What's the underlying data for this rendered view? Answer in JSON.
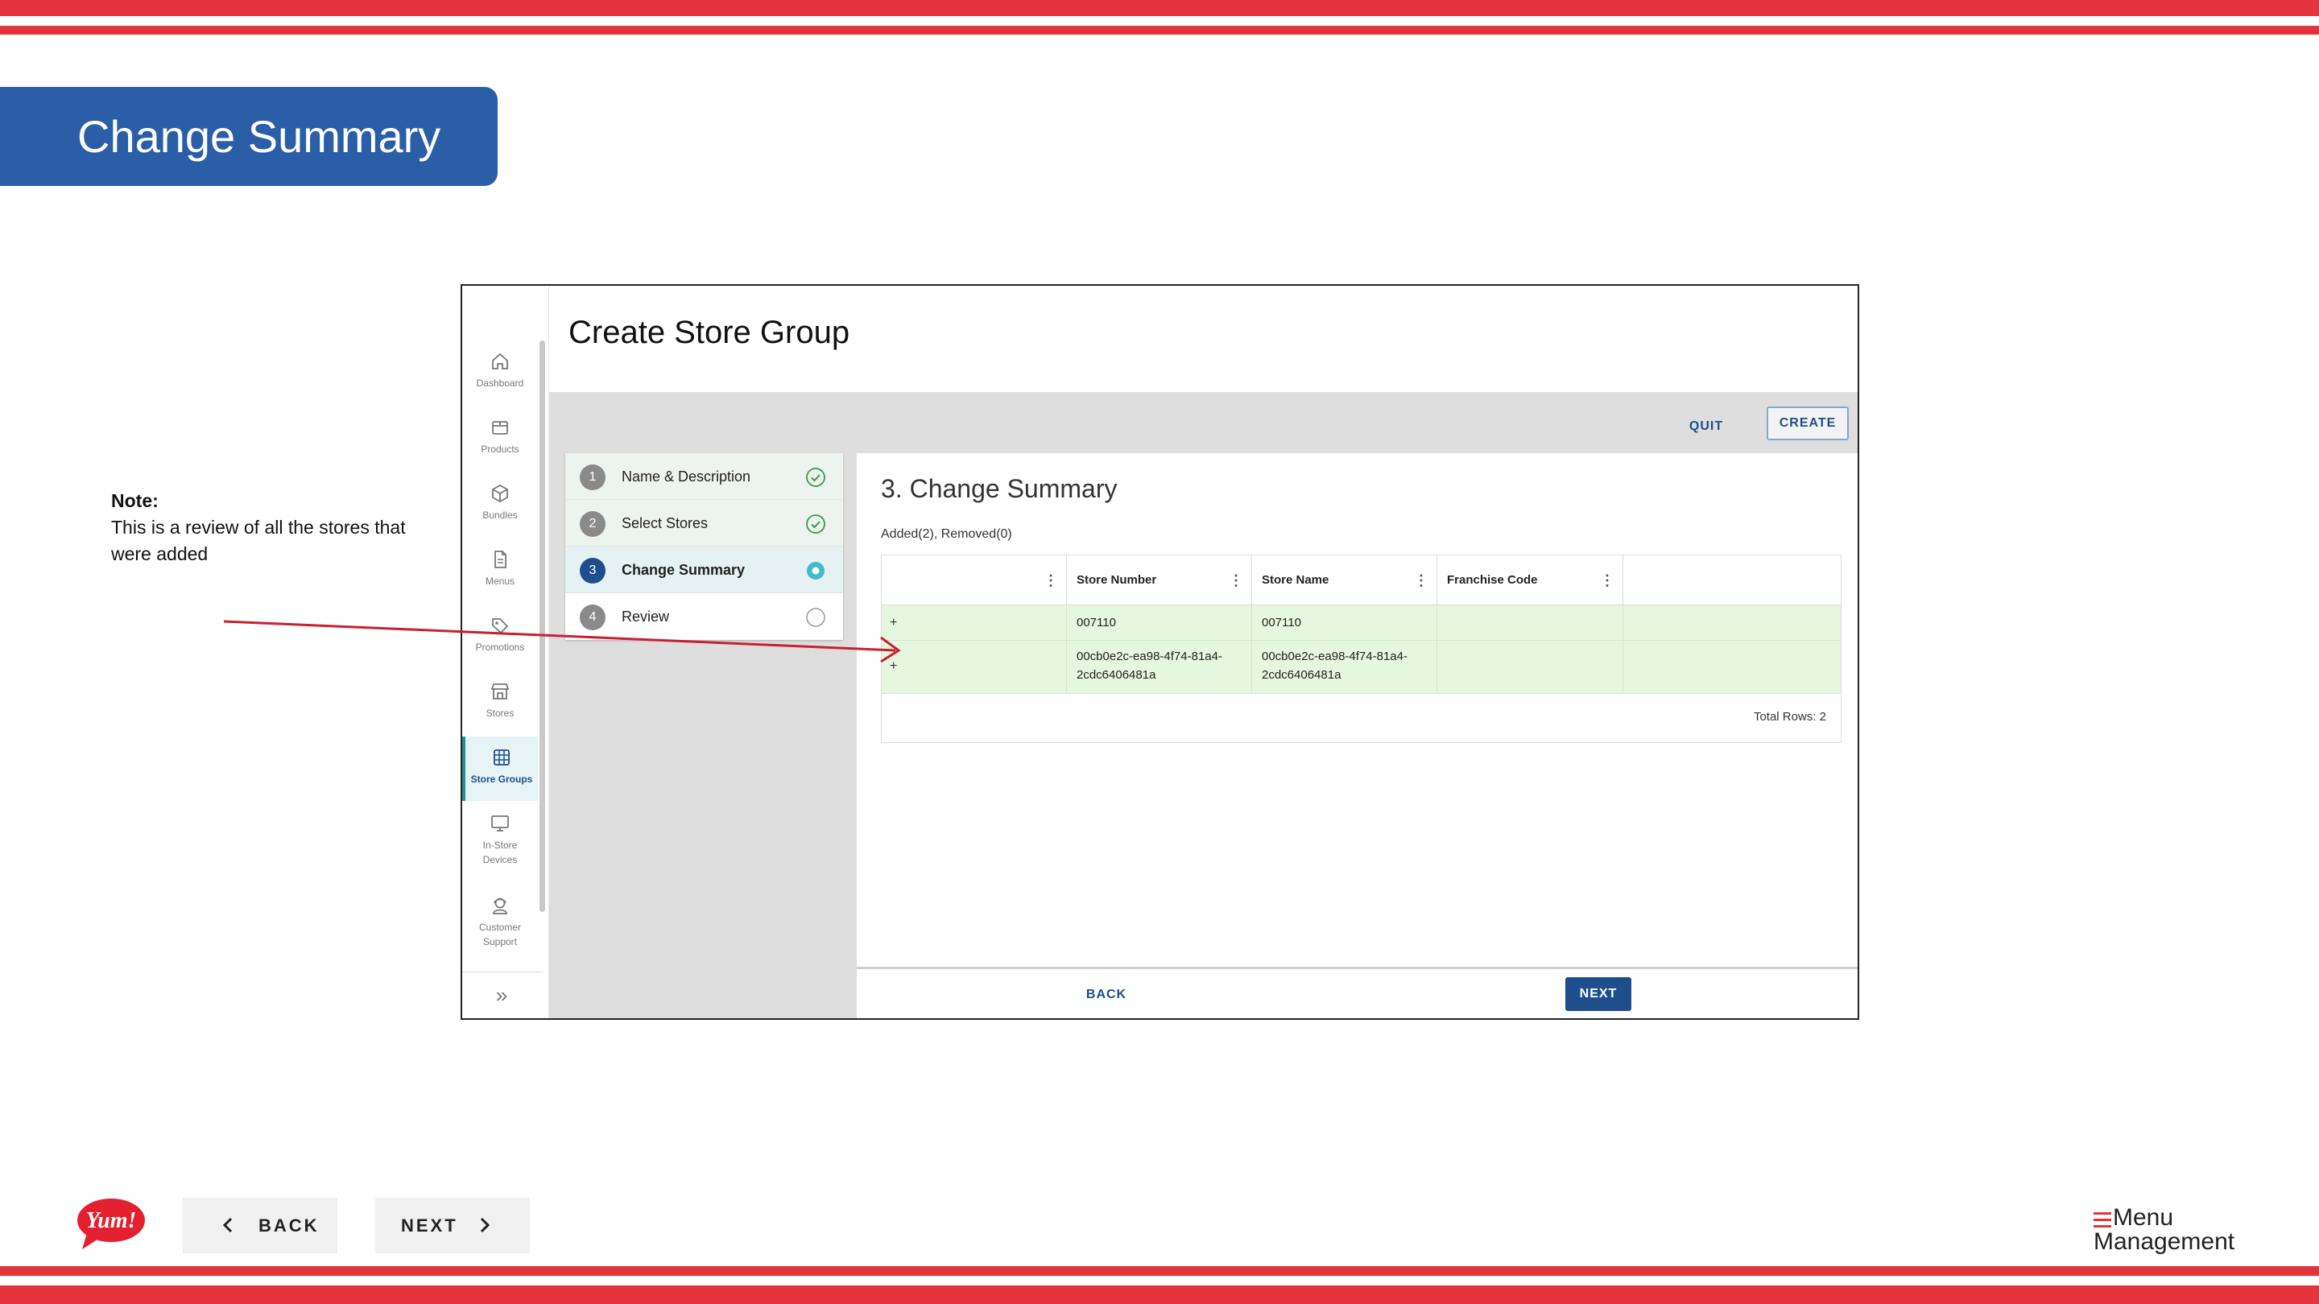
{
  "slide": {
    "title": "Change Summary",
    "note_heading": "Note:",
    "note_text": "This is a review of all the stores that were added"
  },
  "app": {
    "page_title": "Create Store Group",
    "sidebar": {
      "items": [
        {
          "label": "Dashboard",
          "icon": "home-icon"
        },
        {
          "label": "Products",
          "icon": "box-icon"
        },
        {
          "label": "Bundles",
          "icon": "cube-icon"
        },
        {
          "label": "Menus",
          "icon": "document-icon"
        },
        {
          "label": "Promotions",
          "icon": "tag-icon"
        },
        {
          "label": "Stores",
          "icon": "store-icon"
        },
        {
          "label": "Store Groups",
          "icon": "grid-icon",
          "active": true
        },
        {
          "label": "In-Store Devices",
          "icon": "monitor-icon"
        },
        {
          "label": "Customer Support",
          "icon": "support-icon"
        }
      ]
    },
    "toolbar": {
      "quit_label": "QUIT",
      "create_label": "CREATE"
    },
    "steps": [
      {
        "number": "1",
        "label": "Name & Description",
        "status": "complete"
      },
      {
        "number": "2",
        "label": "Select Stores",
        "status": "complete"
      },
      {
        "number": "3",
        "label": "Change Summary",
        "status": "current"
      },
      {
        "number": "4",
        "label": "Review",
        "status": "pending"
      }
    ],
    "summary": {
      "title": "3. Change Summary",
      "subtitle": "Added(2), Removed(0)",
      "columns": [
        "",
        "Store Number",
        "Store Name",
        "Franchise Code"
      ],
      "rows": [
        {
          "flag": "+",
          "store_number": "007110",
          "store_name": "007110",
          "franchise_code": ""
        },
        {
          "flag": "+",
          "store_number": "00cb0e2c-ea98-4f74-81a4-2cdc6406481a",
          "store_name": "00cb0e2c-ea98-4f74-81a4-2cdc6406481a",
          "franchise_code": ""
        }
      ],
      "total_rows": "Total Rows: 2"
    },
    "footer": {
      "back_label": "BACK",
      "next_label": "NEXT"
    }
  },
  "slide_nav": {
    "back_label": "BACK",
    "next_label": "NEXT"
  },
  "brand": {
    "yum_logo_text": "Yum!",
    "menu_management_line1": "Menu",
    "menu_management_line2": "Management"
  },
  "colors": {
    "stripe": "#e3333c",
    "banner": "#2a5ea7",
    "primary": "#1f4e8c",
    "added_row": "#e6f7df",
    "arrow": "#c8202f"
  }
}
